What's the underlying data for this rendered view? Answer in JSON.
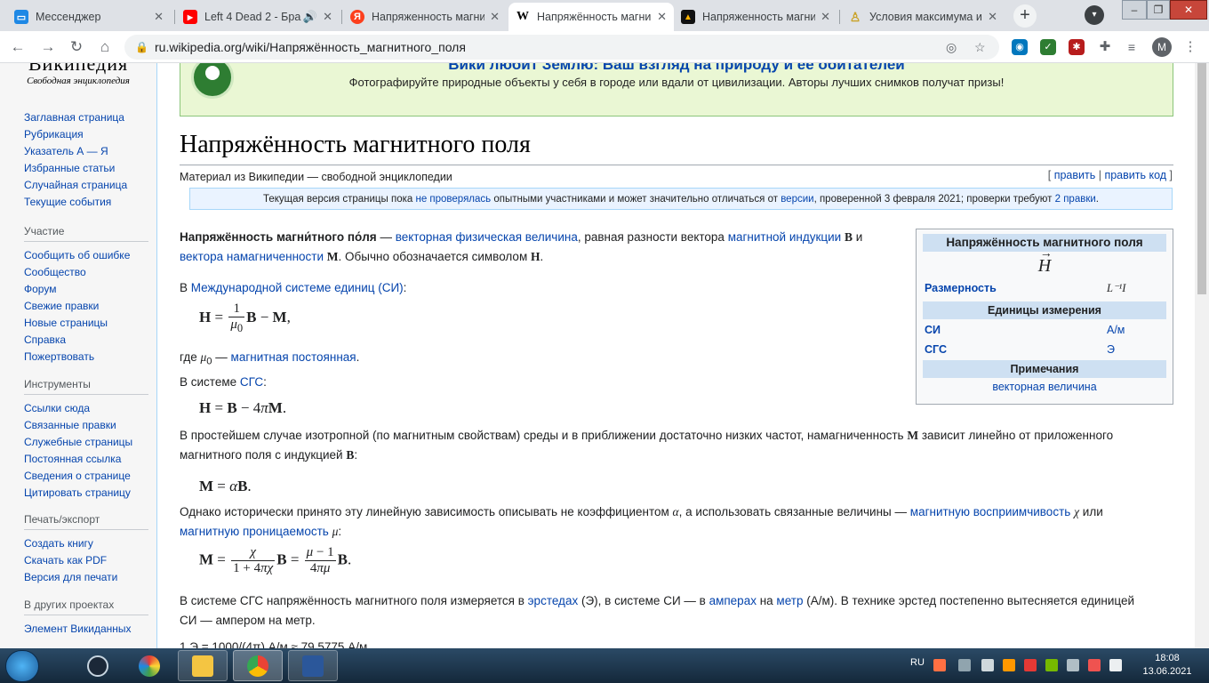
{
  "browser": {
    "tabs": [
      {
        "title": "Мессенджер",
        "favicon": "messenger-icon",
        "color": "#1e88e5",
        "glyph": ""
      },
      {
        "title": "Left 4 Dead 2 - Бра",
        "favicon": "youtube-icon",
        "color": "#ff0000",
        "glyph": "▶"
      },
      {
        "title": "Напряженность магни",
        "favicon": "yandex-icon",
        "color": "#fc3f1d",
        "glyph": "Я"
      },
      {
        "title": "Напряжённость магни",
        "favicon": "wikipedia-icon",
        "color": "#ffffff",
        "glyph": "W"
      },
      {
        "title": "Напряженность магни",
        "favicon": "site-icon",
        "color": "#e65100",
        "glyph": "▲"
      },
      {
        "title": "Условия максимума и",
        "favicon": "site-icon-2",
        "color": "#c9a227",
        "glyph": "♙"
      }
    ],
    "url": "ru.wikipedia.org/wiki/Напряжённость_магнитного_поля",
    "avatar": "M"
  },
  "sidebar": {
    "logo": "Википедия",
    "logo_sub": "Свободная энциклопедия",
    "nav": [
      "Заглавная страница",
      "Рубрикация",
      "Указатель А — Я",
      "Избранные статьи",
      "Случайная страница",
      "Текущие события"
    ],
    "participation": {
      "title": "Участие",
      "items": [
        "Сообщить об ошибке",
        "Сообщество",
        "Форум",
        "Свежие правки",
        "Новые страницы",
        "Справка",
        "Пожертвовать"
      ]
    },
    "tools": {
      "title": "Инструменты",
      "items": [
        "Ссылки сюда",
        "Связанные правки",
        "Служебные страницы",
        "Постоянная ссылка",
        "Сведения о странице",
        "Цитировать страницу"
      ]
    },
    "print": {
      "title": "Печать/экспорт",
      "items": [
        "Создать книгу",
        "Скачать как PDF",
        "Версия для печати"
      ]
    },
    "other": {
      "title": "В других проектах",
      "items": [
        "Элемент Викиданных"
      ]
    }
  },
  "banner": {
    "title": "Вики любит Землю: Ваш взгляд на природу и её обитателей",
    "text": "Фотографируйте природные объекты у себя в городе или вдали от цивилизации. Авторы лучших снимков получат призы!"
  },
  "article": {
    "title": "Напряжённость магнитного поля",
    "tagline": "Материал из Википедии — свободной энциклопедии",
    "edit": "править",
    "edit_code": "править код",
    "notice_pre": "Текущая версия страницы пока ",
    "notice_link1": "не проверялась",
    "notice_mid": " опытными участниками и может значительно отличаться от ",
    "notice_link2": "версии",
    "notice_post": ", проверенной 3 февраля 2021; проверки требуют ",
    "notice_link3": "2 правки",
    "p1_bold": "Напряжённость магни́тного по́ля",
    "p1_a": " — ",
    "p1_l1": "векторная физическая величина",
    "p1_b": ", равная разности вектора ",
    "p1_l2": "магнитной индукции",
    "p1_c": " и",
    "p1_l3": "вектора намагниченности",
    "p1_d": ". Обычно обозначается символом ",
    "p2_pre": "В ",
    "p2_link": "Международной системе единиц (СИ)",
    "p3_pre": "где ",
    "p3_link": "магнитная постоянная",
    "p4_pre": "В системе ",
    "p4_link": "СГС",
    "p5": "В простейшем случае изотропной (по магнитным свойствам) среды и в приближении достаточно низких частот, намагниченность",
    "p5_b": "зависит линейно от приложенного",
    "p5_c": "магнитного поля с индукцией",
    "p6_a": "Однако исторически принято эту линейную зависимость описывать не коэффициентом",
    "p6_b": ", а использовать связанные величины —",
    "p6_l1": "магнитную восприимчивость",
    "p6_c": "или",
    "p6_l2": "магнитную проницаемость",
    "p7_a": "В системе СГС напряжённость магнитного поля измеряется в ",
    "p7_l1": "эрстедах",
    "p7_b": " (Э), в системе СИ — в ",
    "p7_l2": "амперах",
    "p7_c": " на ",
    "p7_l3": "метр",
    "p7_d": " (А/м). В технике эрстед постепенно вытесняется единицей",
    "p7_e": "СИ — ампером на метр.",
    "p8": "1 Э = 1000/(4π) А/м ≈ 79,5775 А/м"
  },
  "infobox": {
    "title": "Напряжённость магнитного поля",
    "symbol": "H",
    "dimension_label": "Размерность",
    "dimension_value": "L⁻¹I",
    "units_header": "Единицы измерения",
    "si_label": "СИ",
    "si_value": "А/м",
    "cgs_label": "СГС",
    "cgs_value": "Э",
    "notes_header": "Примечания",
    "notes_value": "векторная величина"
  },
  "taskbar": {
    "lang": "RU",
    "time": "18:08",
    "date": "13.06.2021"
  }
}
